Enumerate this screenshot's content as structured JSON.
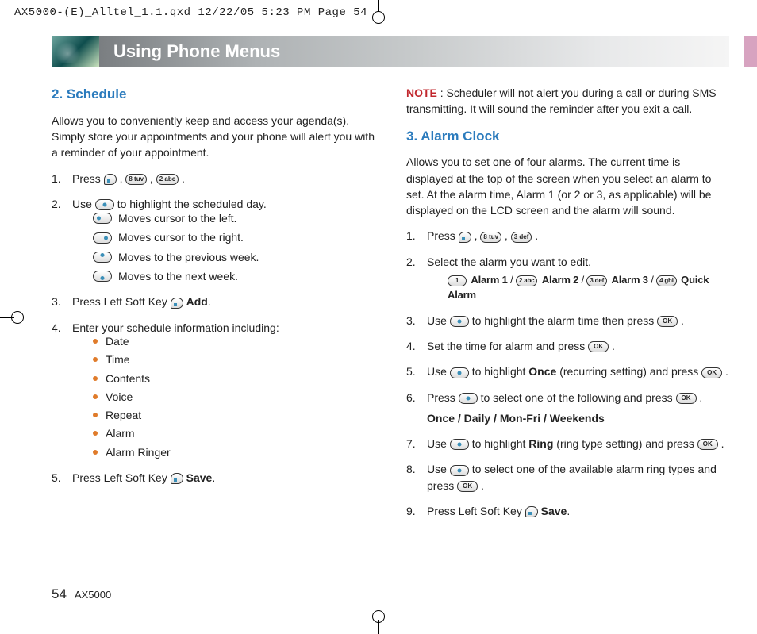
{
  "slug": "AX5000-(E)_Alltel_1.1.qxd  12/22/05  5:23 PM  Page 54",
  "header_title": "Using Phone Menus",
  "page_number": "54",
  "model": "AX5000",
  "left": {
    "heading": "2. Schedule",
    "intro": "Allows you to conveniently keep and access your agenda(s). Simply store your appointments and your phone will alert you with a reminder of your appointment.",
    "step1_a": "Press ",
    "key_8": "8 tuv",
    "key_2": "2 abc",
    "step2_a": "Use ",
    "step2_b": " to highlight the scheduled day.",
    "nav_left": "Moves cursor to the left.",
    "nav_right": "Moves cursor to the right.",
    "nav_up": "Moves to the previous week.",
    "nav_down": "Moves to the next week.",
    "step3_a": "Press Left Soft Key ",
    "step3_b": "Add",
    "step4": "Enter your schedule information including:",
    "bullets": [
      "Date",
      "Time",
      "Contents",
      "Voice",
      "Repeat",
      "Alarm",
      "Alarm Ringer"
    ],
    "step5_a": "Press Left Soft Key ",
    "step5_b": "Save"
  },
  "right": {
    "note_label": "NOTE",
    "note_body": " : Scheduler will not alert you during a call or during SMS transmitting. It will sound the reminder after you exit a call.",
    "heading": "3. Alarm Clock",
    "intro": "Allows you to set one of four alarms. The current time is displayed at the top of the screen when you select an alarm to set. At the alarm time, Alarm 1 (or 2 or 3, as applicable) will be displayed on the LCD screen and the alarm will sound.",
    "step1_a": "Press ",
    "key_8": "8 tuv",
    "key_3": "3 def",
    "step2": "Select the alarm you want to edit.",
    "alarm_k1": "1",
    "alarm_l1": "Alarm 1",
    "alarm_k2": "2 abc",
    "alarm_l2": "Alarm 2",
    "alarm_k3": "3 def",
    "alarm_l3": "Alarm 3",
    "alarm_k4": "4 ghi",
    "alarm_l4": "Quick Alarm",
    "step3_a": "Use ",
    "step3_b": " to highlight the alarm time then press ",
    "step4_a": "Set the time for alarm and press ",
    "step5_a": "Use ",
    "step5_b": " to highlight ",
    "step5_c": "Once",
    "step5_d": " (recurring setting) and press ",
    "step6_a": "Press ",
    "step6_b": " to select one of the following and press ",
    "step6_opts": "Once / Daily / Mon-Fri / Weekends",
    "step7_a": "Use ",
    "step7_b": " to highlight ",
    "step7_c": "Ring",
    "step7_d": " (ring type setting) and press ",
    "step8_a": "Use ",
    "step8_b": " to select one of the available alarm ring types and press ",
    "step9_a": "Press Left Soft Key ",
    "step9_b": "Save",
    "ok": "OK"
  }
}
